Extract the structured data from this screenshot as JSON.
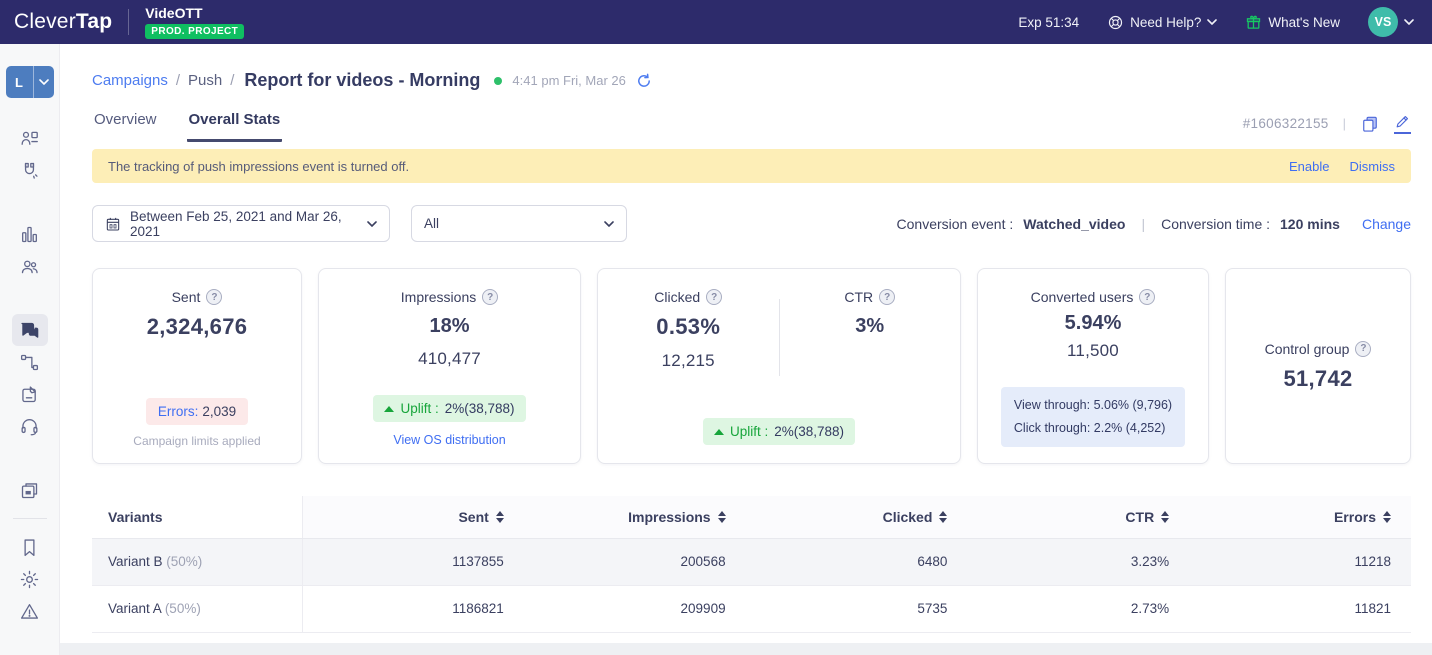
{
  "navbar": {
    "brand_clever": "Clever",
    "brand_tap": "Tap",
    "project_name": "VideOTT",
    "project_badge": "PROD. PROJECT",
    "exp_label": "Exp 51:34",
    "need_help_label": "Need Help?",
    "whats_new_label": "What's New",
    "avatar_initials": "VS"
  },
  "sidebar": {
    "account_initial": "L",
    "icons": [
      "contacts-icon",
      "magnet-icon",
      "bar-chart-icon",
      "users-icon",
      "messages-icon",
      "journeys-icon",
      "pages-icon",
      "support-icon",
      "boards-icon",
      "bookmark-icon",
      "settings-icon",
      "alerts-icon"
    ],
    "active_item": "messages-icon"
  },
  "breadcrumb": {
    "campaigns": "Campaigns",
    "separator": "/",
    "push": "Push",
    "title": "Report for videos - Morning",
    "timestamp": "4:41 pm Fri, Mar 26"
  },
  "tabs": {
    "overview_label": "Overview",
    "overall_stats_label": "Overall Stats",
    "campaign_id": "#1606322155",
    "id_separator": "|"
  },
  "banner": {
    "message": "The tracking of push impressions event is turned off.",
    "enable_label": "Enable",
    "dismiss_label": "Dismiss"
  },
  "filters": {
    "date_range": "Between Feb 25, 2021 and Mar 26, 2021",
    "segment_value": "All",
    "conversion_event_label": "Conversion event :",
    "conversion_event_value": "Watched_video",
    "separator": "|",
    "conversion_time_label": "Conversion time :",
    "conversion_time_value": "120 mins",
    "change_label": "Change"
  },
  "misc": {
    "help_glyph": "?"
  },
  "cards": {
    "sent": {
      "label": "Sent",
      "value": "2,324,676",
      "errors_label": "Errors:",
      "errors_value": "2,039",
      "footnote": "Campaign limits applied"
    },
    "impressions": {
      "label": "Impressions",
      "percent": "18%",
      "value": "410,477",
      "uplift_prefix": "Uplift :",
      "uplift_value": "2%(38,788)",
      "os_link": "View OS distribution"
    },
    "clicked": {
      "label": "Clicked",
      "percent": "0.53%",
      "value": "12,215"
    },
    "ctr": {
      "label": "CTR",
      "percent": "3%"
    },
    "clicked_uplift": {
      "uplift_prefix": "Uplift :",
      "uplift_value": "2%(38,788)"
    },
    "converted": {
      "label": "Converted users",
      "percent": "5.94%",
      "value": "11,500",
      "view_through": "View through: 5.06% (9,796)",
      "click_through": "Click through: 2.2% (4,252)"
    },
    "control": {
      "label": "Control group",
      "value": "51,742"
    }
  },
  "table": {
    "headers": [
      "Variants",
      "Sent",
      "Impressions",
      "Clicked",
      "CTR",
      "Errors"
    ],
    "rows": [
      {
        "name": "Variant B",
        "split": "(50%)",
        "sent": "1137855",
        "impressions": "200568",
        "clicked": "6480",
        "ctr": "3.23%",
        "errors": "11218"
      },
      {
        "name": "Variant A",
        "split": "(50%)",
        "sent": "1186821",
        "impressions": "209909",
        "clicked": "5735",
        "ctr": "2.73%",
        "errors": "11821"
      }
    ]
  },
  "colors": {
    "navbar_bg": "#2d2b6b",
    "badge_green": "#0fbf61",
    "avatar_teal": "#3fbcaa",
    "link_blue": "#3f6ef2",
    "uplift_green": "#17a53b",
    "uplift_green_bg": "#def6e2",
    "error_pink_bg": "#fce9e9",
    "info_blue_bg": "#e5ecfa",
    "banner_yellow_bg": "#fdeeb7",
    "live_dot_green": "#2ec06a",
    "sidebar_account_blue": "#4d7dbf"
  }
}
